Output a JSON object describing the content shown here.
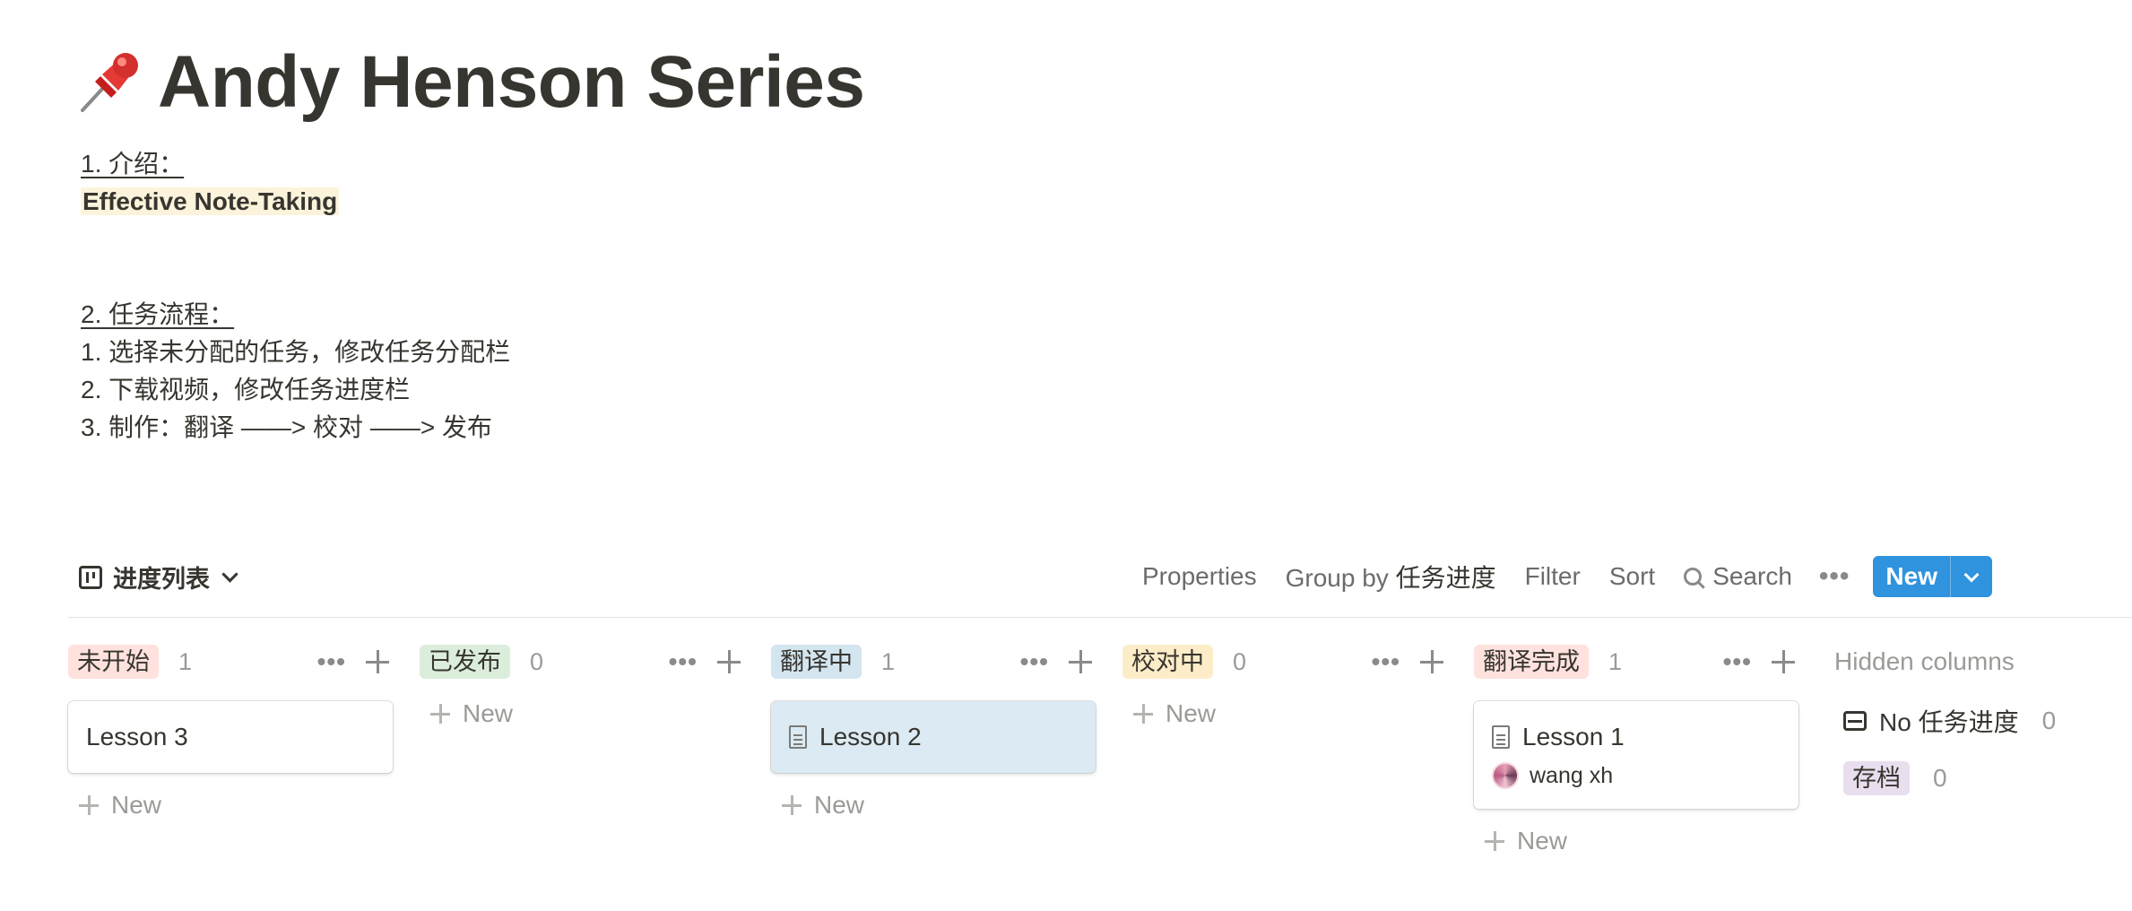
{
  "page": {
    "title": "Andy Henson Series",
    "icon": "pushpin-icon"
  },
  "description": {
    "intro_heading": "1. 介绍：",
    "intro_link": "Effective Note-Taking",
    "flow_heading": "2. 任务流程：",
    "steps": [
      "1. 选择未分配的任务，修改任务分配栏",
      "2. 下载视频，修改任务进度栏",
      "3. 制作：翻译 ——> 校对 ——> 发布"
    ]
  },
  "viewbar": {
    "view_name": "进度列表",
    "properties": "Properties",
    "group_by_prefix": "Group by",
    "group_by_value": "任务进度",
    "filter": "Filter",
    "sort": "Sort",
    "search": "Search",
    "more": "•••",
    "new_label": "New"
  },
  "columns": [
    {
      "label": "未开始",
      "count": "1",
      "color": "#ffe2dd",
      "cards": [
        {
          "title": "Lesson 3"
        }
      ]
    },
    {
      "label": "已发布",
      "count": "0",
      "color": "#dbeddb",
      "cards": []
    },
    {
      "label": "翻译中",
      "count": "1",
      "color": "#d3e5ef",
      "cards": [
        {
          "title": "Lesson 2"
        }
      ]
    },
    {
      "label": "校对中",
      "count": "0",
      "color": "#fdecc8",
      "cards": []
    },
    {
      "label": "翻译完成",
      "count": "1",
      "color": "#ffe2dd",
      "cards": [
        {
          "title": "Lesson 1",
          "assignee": "wang xh"
        }
      ]
    }
  ],
  "add_new_label": "New",
  "hidden_columns": {
    "heading": "Hidden columns",
    "items": [
      {
        "label": "No 任务进度",
        "count": "0"
      },
      {
        "label": "存档",
        "count": "0",
        "color": "#e8deee"
      }
    ]
  }
}
